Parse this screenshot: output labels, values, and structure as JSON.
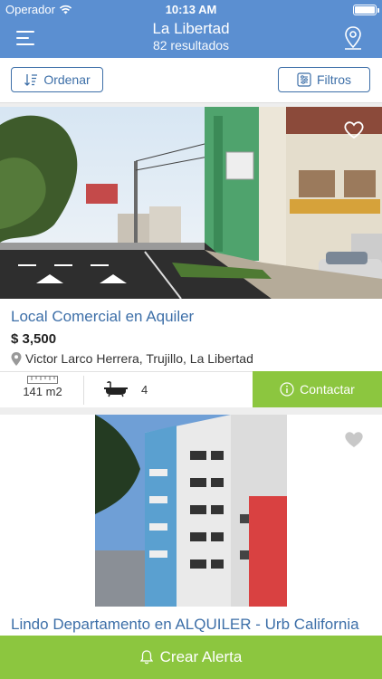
{
  "status_bar": {
    "carrier": "Operador",
    "time": "10:13 AM",
    "battery_level": 1.0
  },
  "navbar": {
    "title": "La Libertad",
    "subtitle": "82 resultados",
    "menu_icon": "hamburger-menu-icon",
    "map_icon": "map-pin-icon"
  },
  "filters": {
    "order_label": "Ordenar",
    "filter_label": "Filtros"
  },
  "listings": [
    {
      "title": "Local Comercial en Aquiler",
      "price": "$ 3,500",
      "address": "Victor Larco Herrera, Trujillo, La Libertad",
      "area": "141 m2",
      "bathrooms": "4",
      "contact_label": "Contactar"
    },
    {
      "title": "Lindo Departamento en ALQUILER - Urb California"
    }
  ],
  "bottom_bar": {
    "label": "Crear Alerta"
  },
  "colors": {
    "header_blue": "#5b8fd1",
    "link_blue": "#3d6fa8",
    "accent_green": "#8cc63f"
  }
}
